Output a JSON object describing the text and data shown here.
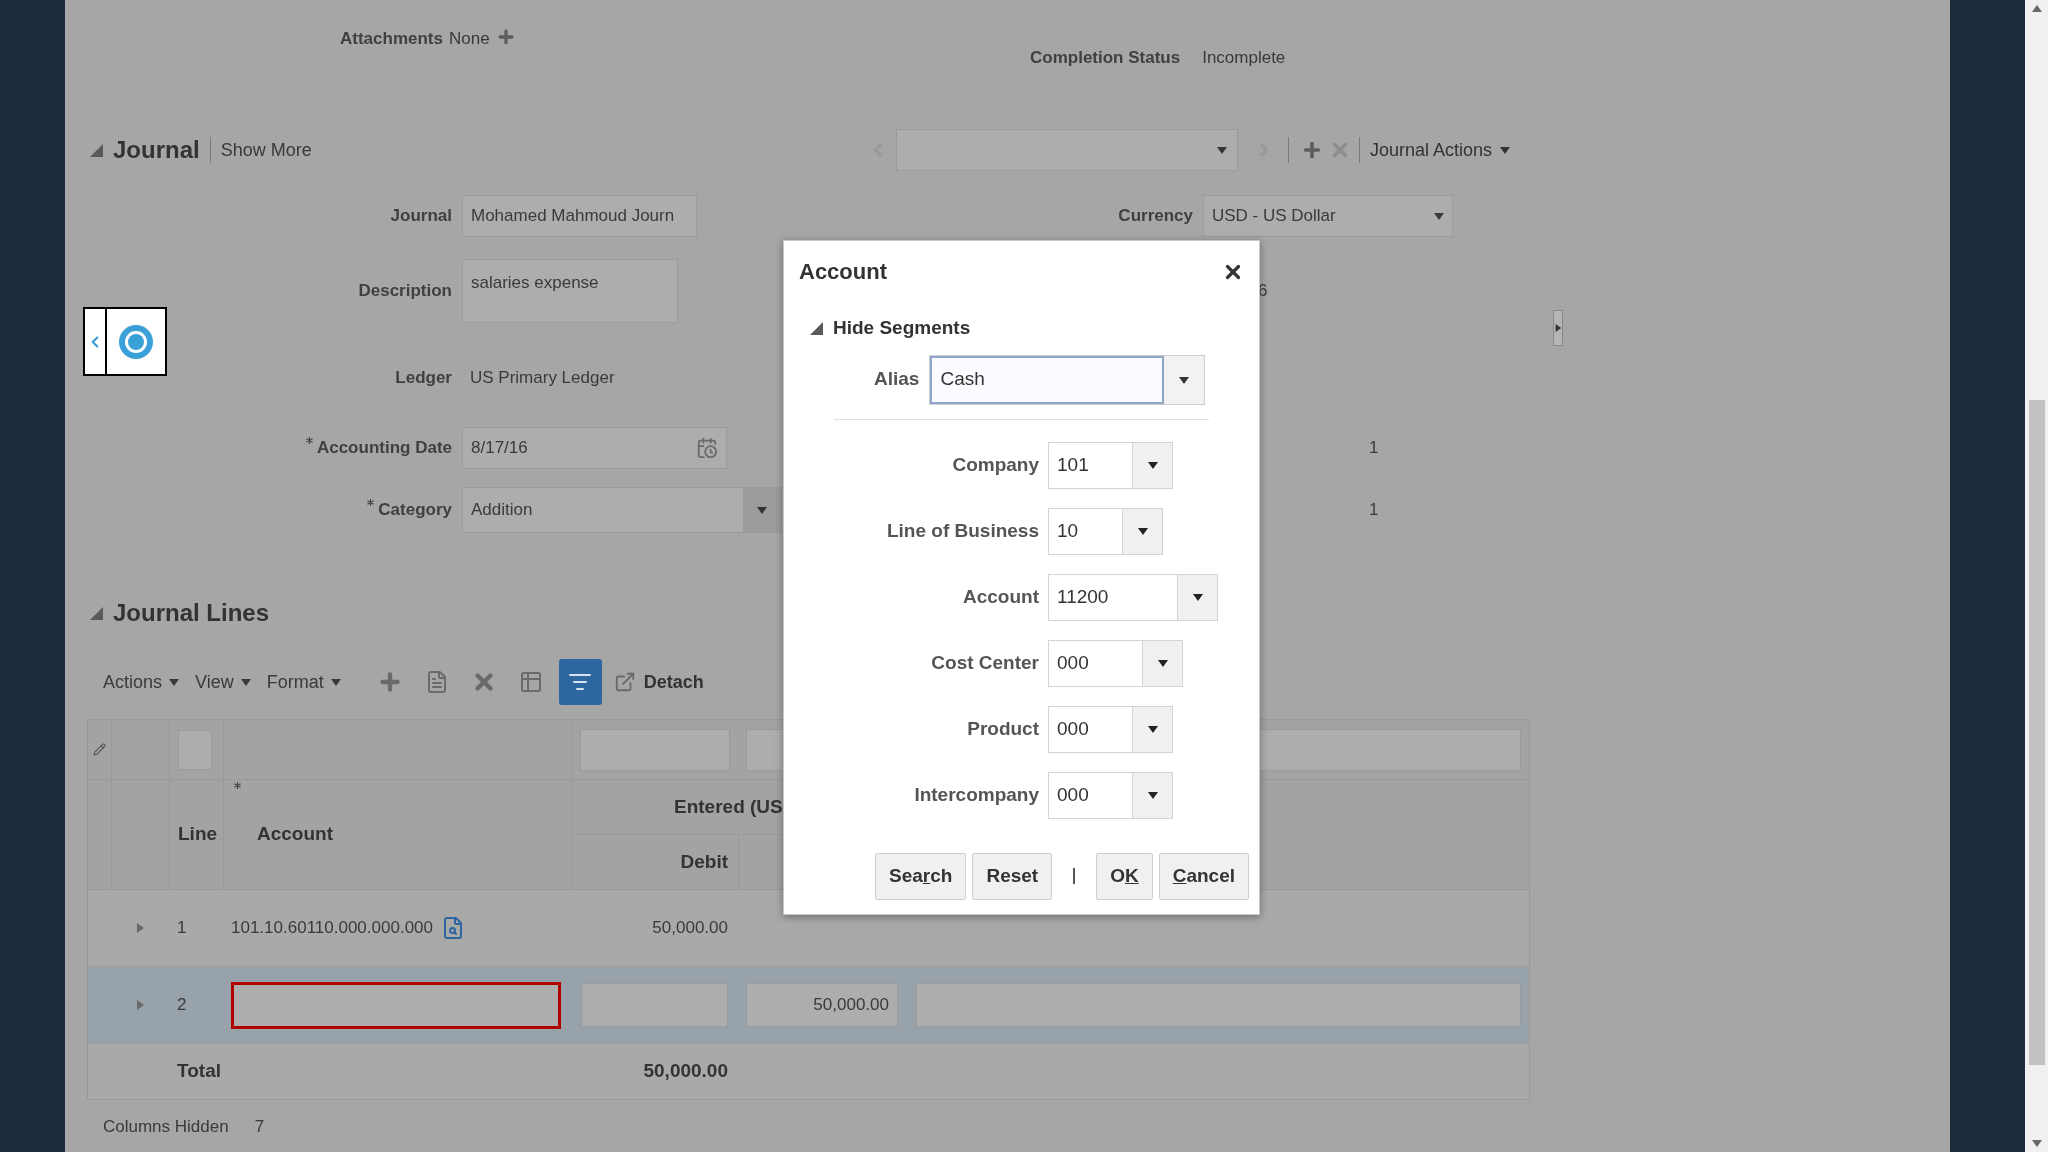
{
  "attachments": {
    "label": "Attachments",
    "value": "None"
  },
  "completion_status": {
    "label": "Completion Status",
    "value": "Incomplete"
  },
  "journal": {
    "title": "Journal",
    "expanded": true,
    "show_more": "Show More",
    "actions": "Journal Actions",
    "fields": [
      {
        "label": "Journal",
        "value": "Mohamed Mahmoud Journ",
        "kind": "input",
        "required": false
      },
      {
        "label": "Description",
        "value": "salaries expense",
        "kind": "textarea",
        "required": false
      },
      {
        "label": "Ledger",
        "value": "US Primary Ledger",
        "kind": "text",
        "required": false
      },
      {
        "label": "Accounting Date",
        "value": "8/17/16",
        "kind": "date",
        "required": true
      },
      {
        "label": "Category",
        "value": "Addition",
        "kind": "select",
        "required": true
      }
    ],
    "currency": {
      "label": "Currency",
      "value": "USD - US Dollar"
    },
    "partial_values": [
      "6",
      "1",
      "1"
    ]
  },
  "journal_lines": {
    "title": "Journal Lines",
    "expanded": true,
    "menus": [
      "Actions",
      "View",
      "Format"
    ],
    "detach": "Detach",
    "columns": {
      "line": "Line",
      "account": "Account",
      "entered": "Entered (US",
      "debit": "Debit"
    },
    "rows": [
      {
        "line": "1",
        "account": "101.10.60110.000.000.000",
        "debit": "50,000.00",
        "selected": false
      },
      {
        "line": "2",
        "credit": "50,000.00",
        "selected": true,
        "invalid": true
      }
    ],
    "total": {
      "label": "Total",
      "debit": "50,000.00"
    },
    "columns_hidden": {
      "label": "Columns Hidden",
      "value": "7"
    }
  },
  "dialog": {
    "title": "Account",
    "segments_toggle": {
      "label": "Hide Segments",
      "expanded": true
    },
    "alias": {
      "label": "Alias",
      "value": "Cash"
    },
    "segments": [
      {
        "label": "Company",
        "value": "101"
      },
      {
        "label": "Line of Business",
        "value": "10"
      },
      {
        "label": "Account",
        "value": "11200"
      },
      {
        "label": "Cost Center",
        "value": "000"
      },
      {
        "label": "Product",
        "value": "000"
      },
      {
        "label": "Intercompany",
        "value": "000"
      }
    ],
    "buttons": [
      {
        "label_parts": [
          {
            "text": "Sea",
            "underlined": false
          },
          {
            "text": "r",
            "underlined": true
          },
          {
            "text": "ch",
            "underlined": false
          }
        ]
      },
      {
        "label_parts": [
          {
            "text": "Reset",
            "underlined": false
          }
        ]
      },
      {
        "label_parts": [
          {
            "text": "O",
            "underlined": false
          },
          {
            "text": "K",
            "underlined": true
          }
        ]
      },
      {
        "label_parts": [
          {
            "text": "C",
            "underlined": true
          },
          {
            "text": "ancel",
            "underlined": false
          }
        ]
      }
    ]
  }
}
